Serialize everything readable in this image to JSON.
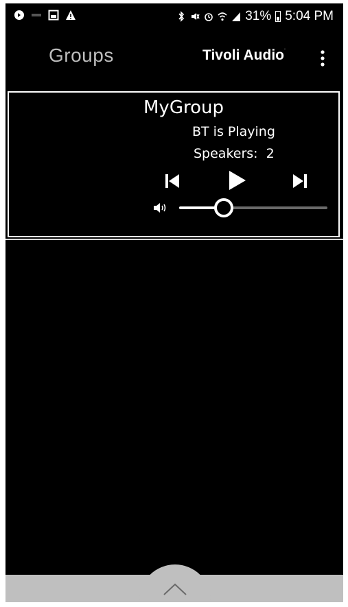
{
  "status_bar": {
    "battery_percent": "31%",
    "time": "5:04 PM"
  },
  "app_bar": {
    "title": "Groups",
    "brand": "Tivoli Audio",
    "brand_mark": "·"
  },
  "group": {
    "name": "MyGroup",
    "status": "BT is Playing",
    "speakers_label": "Speakers:  2",
    "volume_level": 0.3
  },
  "icons": {
    "status_left": [
      "app-notification-icon",
      "minus-notification-icon",
      "image-notification-icon",
      "warning-notification-icon"
    ],
    "status_right": [
      "bluetooth-icon",
      "mute-icon",
      "alarm-icon",
      "wifi-icon",
      "signal-icon",
      "battery-icon"
    ],
    "controls": [
      "previous-track-icon",
      "play-icon",
      "next-track-icon",
      "volume-icon"
    ],
    "drawer": "chevron-up-icon",
    "menu": "overflow-menu-icon"
  },
  "colors": {
    "background": "#000000",
    "text_primary": "#ffffff",
    "text_secondary": "#bdbdbd",
    "drawer": "#bfbfbf"
  }
}
